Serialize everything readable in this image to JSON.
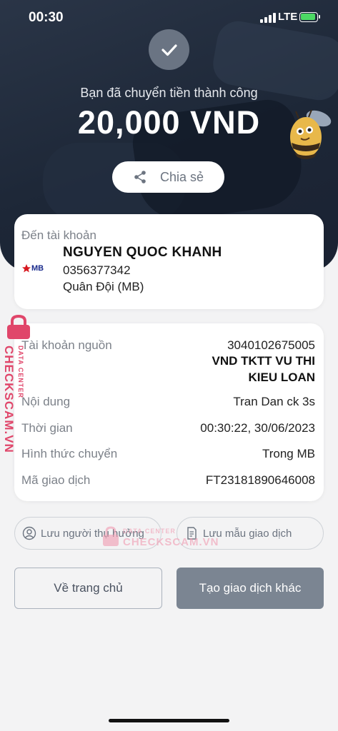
{
  "status_bar": {
    "time": "00:30",
    "network": "LTE"
  },
  "header": {
    "success_message": "Bạn đã chuyển tiền thành công",
    "amount": "20,000 VND",
    "share_label": "Chia sẻ"
  },
  "recipient": {
    "label": "Đến tài khoản",
    "bank_logo": "MB",
    "name": "NGUYEN QUOC KHANH",
    "account_number": "0356377342",
    "bank_name": "Quân Đội (MB)"
  },
  "details": {
    "source_account": {
      "label": "Tài khoản nguồn",
      "number": "3040102675005",
      "name_line1": "VND TKTT VU THI",
      "name_line2": "KIEU LOAN"
    },
    "content": {
      "label": "Nội dung",
      "value": "Tran Dan ck 3s"
    },
    "time": {
      "label": "Thời gian",
      "value": "00:30:22, 30/06/2023"
    },
    "method": {
      "label": "Hình thức chuyển",
      "value": "Trong MB"
    },
    "transaction_id": {
      "label": "Mã giao dịch",
      "value": "FT23181890646008"
    }
  },
  "actions": {
    "save_recipient": "Lưu người thụ hưởng",
    "save_template": "Lưu mẫu giao dịch",
    "home": "Về trang chủ",
    "new_transaction": "Tạo giao dịch khác"
  },
  "watermark": {
    "brand": "CHECKSCAM.VN",
    "sub": "DATA CENTER"
  },
  "colors": {
    "header_bg": "#1f2a3a",
    "primary_button": "#7b8592",
    "watermark": "#e0466a",
    "mb_red": "#d71920",
    "mb_blue": "#1a2b8c"
  },
  "icons": [
    "check-icon",
    "share-icon",
    "user-circle-icon",
    "document-icon",
    "lock-icon",
    "mb-star-icon"
  ]
}
